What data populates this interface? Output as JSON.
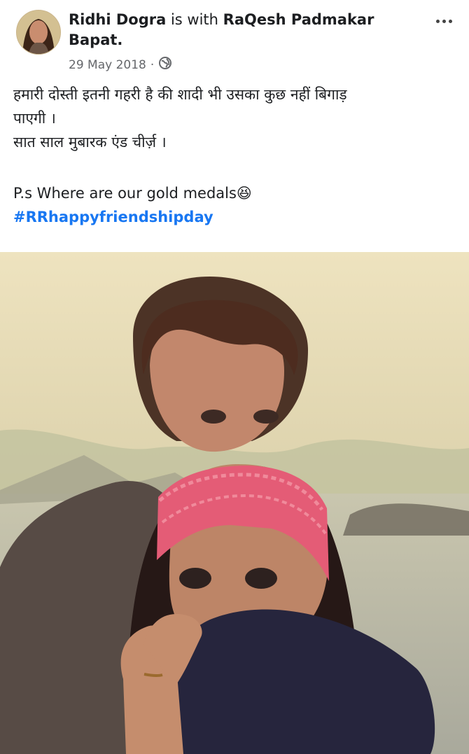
{
  "post": {
    "author_name": "Ridhi Dogra",
    "with_text": "is with",
    "tagged_name": "RaQesh Padmakar Bapat.",
    "date": "29 May 2018",
    "separator": "·",
    "privacy_icon": "globe-icon",
    "more_icon": "more-options-icon",
    "text_lines": [
      "हमारी दोस्ती इतनी गहरी है की शादी भी उसका कुछ नहीं बिगाड़",
      "पाएगी ।",
      "सात साल मुबारक एंड चीर्ज़ ।"
    ],
    "ps_text": "P.s Where are our gold medals",
    "ps_emoji": "😆",
    "hashtag": "#RRhappyfriendshipday"
  },
  "colors": {
    "hashtag": "#1877f2",
    "secondary_text": "#65676b",
    "headband": "#e75d78"
  }
}
